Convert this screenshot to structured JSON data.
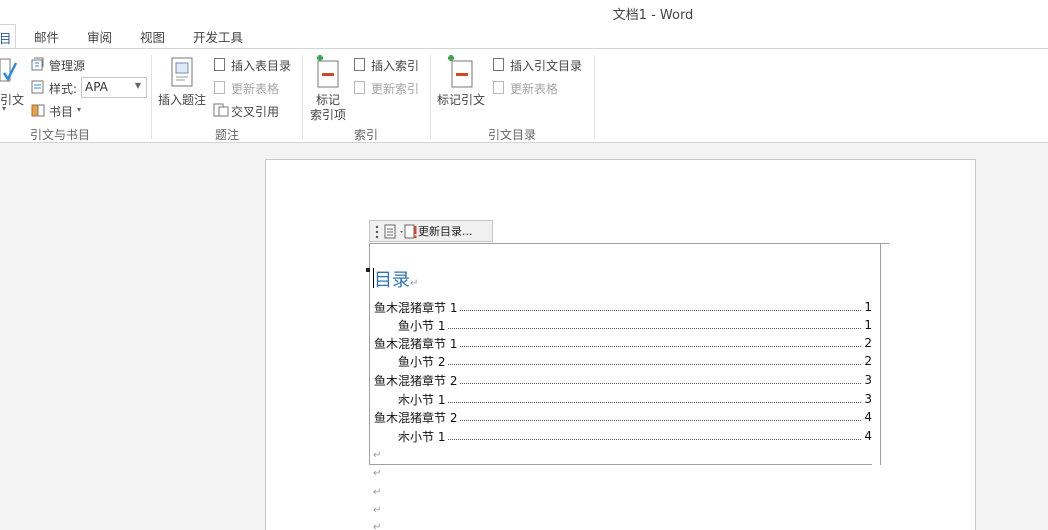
{
  "window": {
    "title": "文档1 - Word"
  },
  "tabs": [
    {
      "label": "目",
      "active": true
    },
    {
      "label": "邮件"
    },
    {
      "label": "审阅"
    },
    {
      "label": "视图"
    },
    {
      "label": "开发工具"
    }
  ],
  "ribbon": {
    "citations_group": {
      "label": "引文与书目",
      "insert_citation": "引文",
      "manage_sources": "管理源",
      "style_label": "样式:",
      "style_value": "APA",
      "bibliography": "书目"
    },
    "captions_group": {
      "label": "题注",
      "insert_caption": "插入题注",
      "insert_table_of_figures": "插入表目录",
      "update_table": "更新表格",
      "cross_reference": "交叉引用"
    },
    "index_group": {
      "label": "索引",
      "mark_entry_line1": "标记",
      "mark_entry_line2": "索引项",
      "insert_index": "插入索引",
      "update_index": "更新索引"
    },
    "toa_group": {
      "label": "引文目录",
      "mark_citation": "标记引文",
      "insert_toa": "插入引文目录",
      "update_table": "更新表格"
    }
  },
  "toc_toolbar": {
    "update_label": "更新目录..."
  },
  "toc": {
    "heading": "目录",
    "entries": [
      {
        "text": "鱼木混猪章节 1",
        "page": "1",
        "level": 1
      },
      {
        "text": "鱼小节 1",
        "page": "1",
        "level": 2
      },
      {
        "text": "鱼木混猪章节 1",
        "page": "2",
        "level": 1
      },
      {
        "text": "鱼小节 2",
        "page": "2",
        "level": 2
      },
      {
        "text": "鱼木混猪章节 2",
        "page": "3",
        "level": 1
      },
      {
        "text": "木小节 1",
        "page": "3",
        "level": 2
      },
      {
        "text": "鱼木混猪章节 2",
        "page": "4",
        "level": 1
      },
      {
        "text": "木小节 1",
        "page": "4",
        "level": 2
      }
    ],
    "para_mark": "↵"
  },
  "colors": {
    "accent": "#2b579a",
    "heading": "#2e74b5"
  }
}
